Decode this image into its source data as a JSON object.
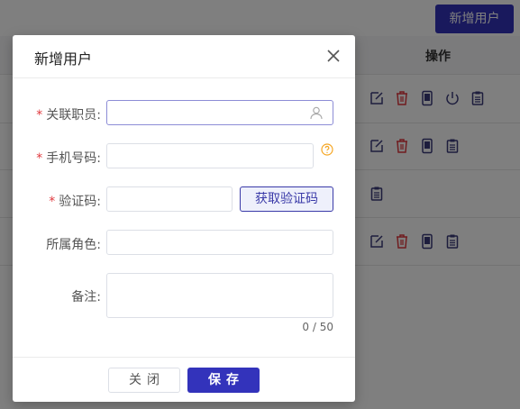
{
  "toolbar": {
    "add_user_label": "新增用户"
  },
  "table": {
    "op_header": "操作"
  },
  "dialog": {
    "title": "新增用户",
    "fields": {
      "staff": {
        "label": "关联职员",
        "required_mark": "*",
        "suffix": ":"
      },
      "phone": {
        "label": "手机号码",
        "required_mark": "*",
        "suffix": ":"
      },
      "code": {
        "label": "验证码",
        "required_mark": "*",
        "suffix": ":",
        "button": "获取验证码"
      },
      "role": {
        "label": "所属角色",
        "suffix": ":"
      },
      "note": {
        "label": "备注",
        "suffix": ":",
        "counter": "0 / 50"
      }
    },
    "footer": {
      "close_label": "关闭",
      "save_label": "保存"
    }
  },
  "colors": {
    "primary": "#3333bb",
    "danger": "#e0393e",
    "help": "#f5a623"
  },
  "icons": [
    "edit-icon",
    "delete-icon",
    "phone-icon",
    "power-icon",
    "clipboard-icon",
    "user-icon",
    "help-icon",
    "close-icon"
  ]
}
